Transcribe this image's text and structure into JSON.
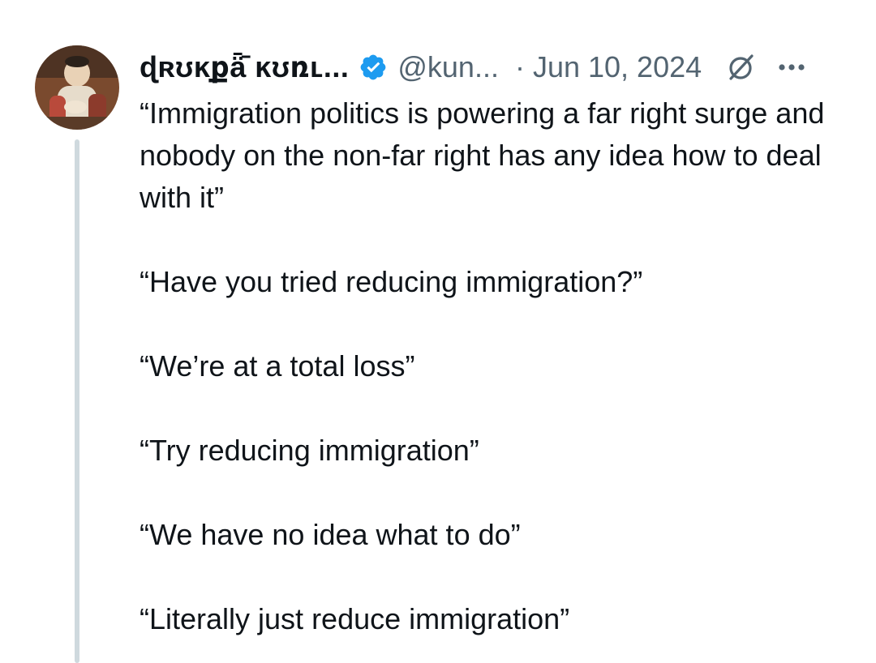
{
  "author": {
    "display_name": "ɖʀʊĸքǟ̄ ĸʊռʟ...",
    "handle": "@kun...",
    "verified": true,
    "date_separator": "·",
    "date": "Jun 10, 2024"
  },
  "icons": {
    "verified": "verified-badge-icon",
    "grok": "grok-icon",
    "more": "more-options-icon"
  },
  "colors": {
    "verified_blue": "#1d9bf0",
    "secondary_text": "#536471",
    "primary_text": "#0f1419",
    "thread_line": "#cfd9de"
  },
  "tweet": {
    "paragraphs": [
      "“Immigration politics is powering a far right surge and nobody on the non-far right has any idea how to deal with it”",
      "“Have you tried reducing immigration?”",
      "“We’re at a total loss”",
      "“Try reducing immigration”",
      "“We have no idea what to do”",
      "“Literally just reduce immigration”"
    ]
  }
}
